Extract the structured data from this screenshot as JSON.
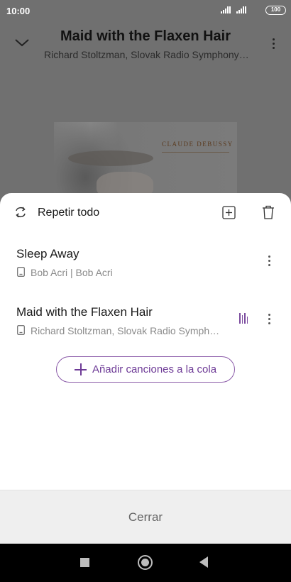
{
  "status_bar": {
    "time": "10:00",
    "battery": "100"
  },
  "player": {
    "title": "Maid with the Flaxen Hair",
    "artist": "Richard Stoltzman, Slovak Radio Symphony Orchestra",
    "album_art_text": "CLAUDE DEBUSSY"
  },
  "queue_sheet": {
    "repeat_label": "Repetir todo",
    "items": [
      {
        "title": "Sleep Away",
        "subtitle": "Bob Acri | Bob Acri",
        "now_playing": false
      },
      {
        "title": "Maid with the Flaxen Hair",
        "subtitle": "Richard Stoltzman, Slovak Radio Symphony Orchestra",
        "now_playing": true
      }
    ],
    "add_to_queue_label": "Añadir canciones a la cola",
    "close_label": "Cerrar"
  },
  "colors": {
    "accent": "#6d3a96",
    "overlay": "#707070"
  }
}
